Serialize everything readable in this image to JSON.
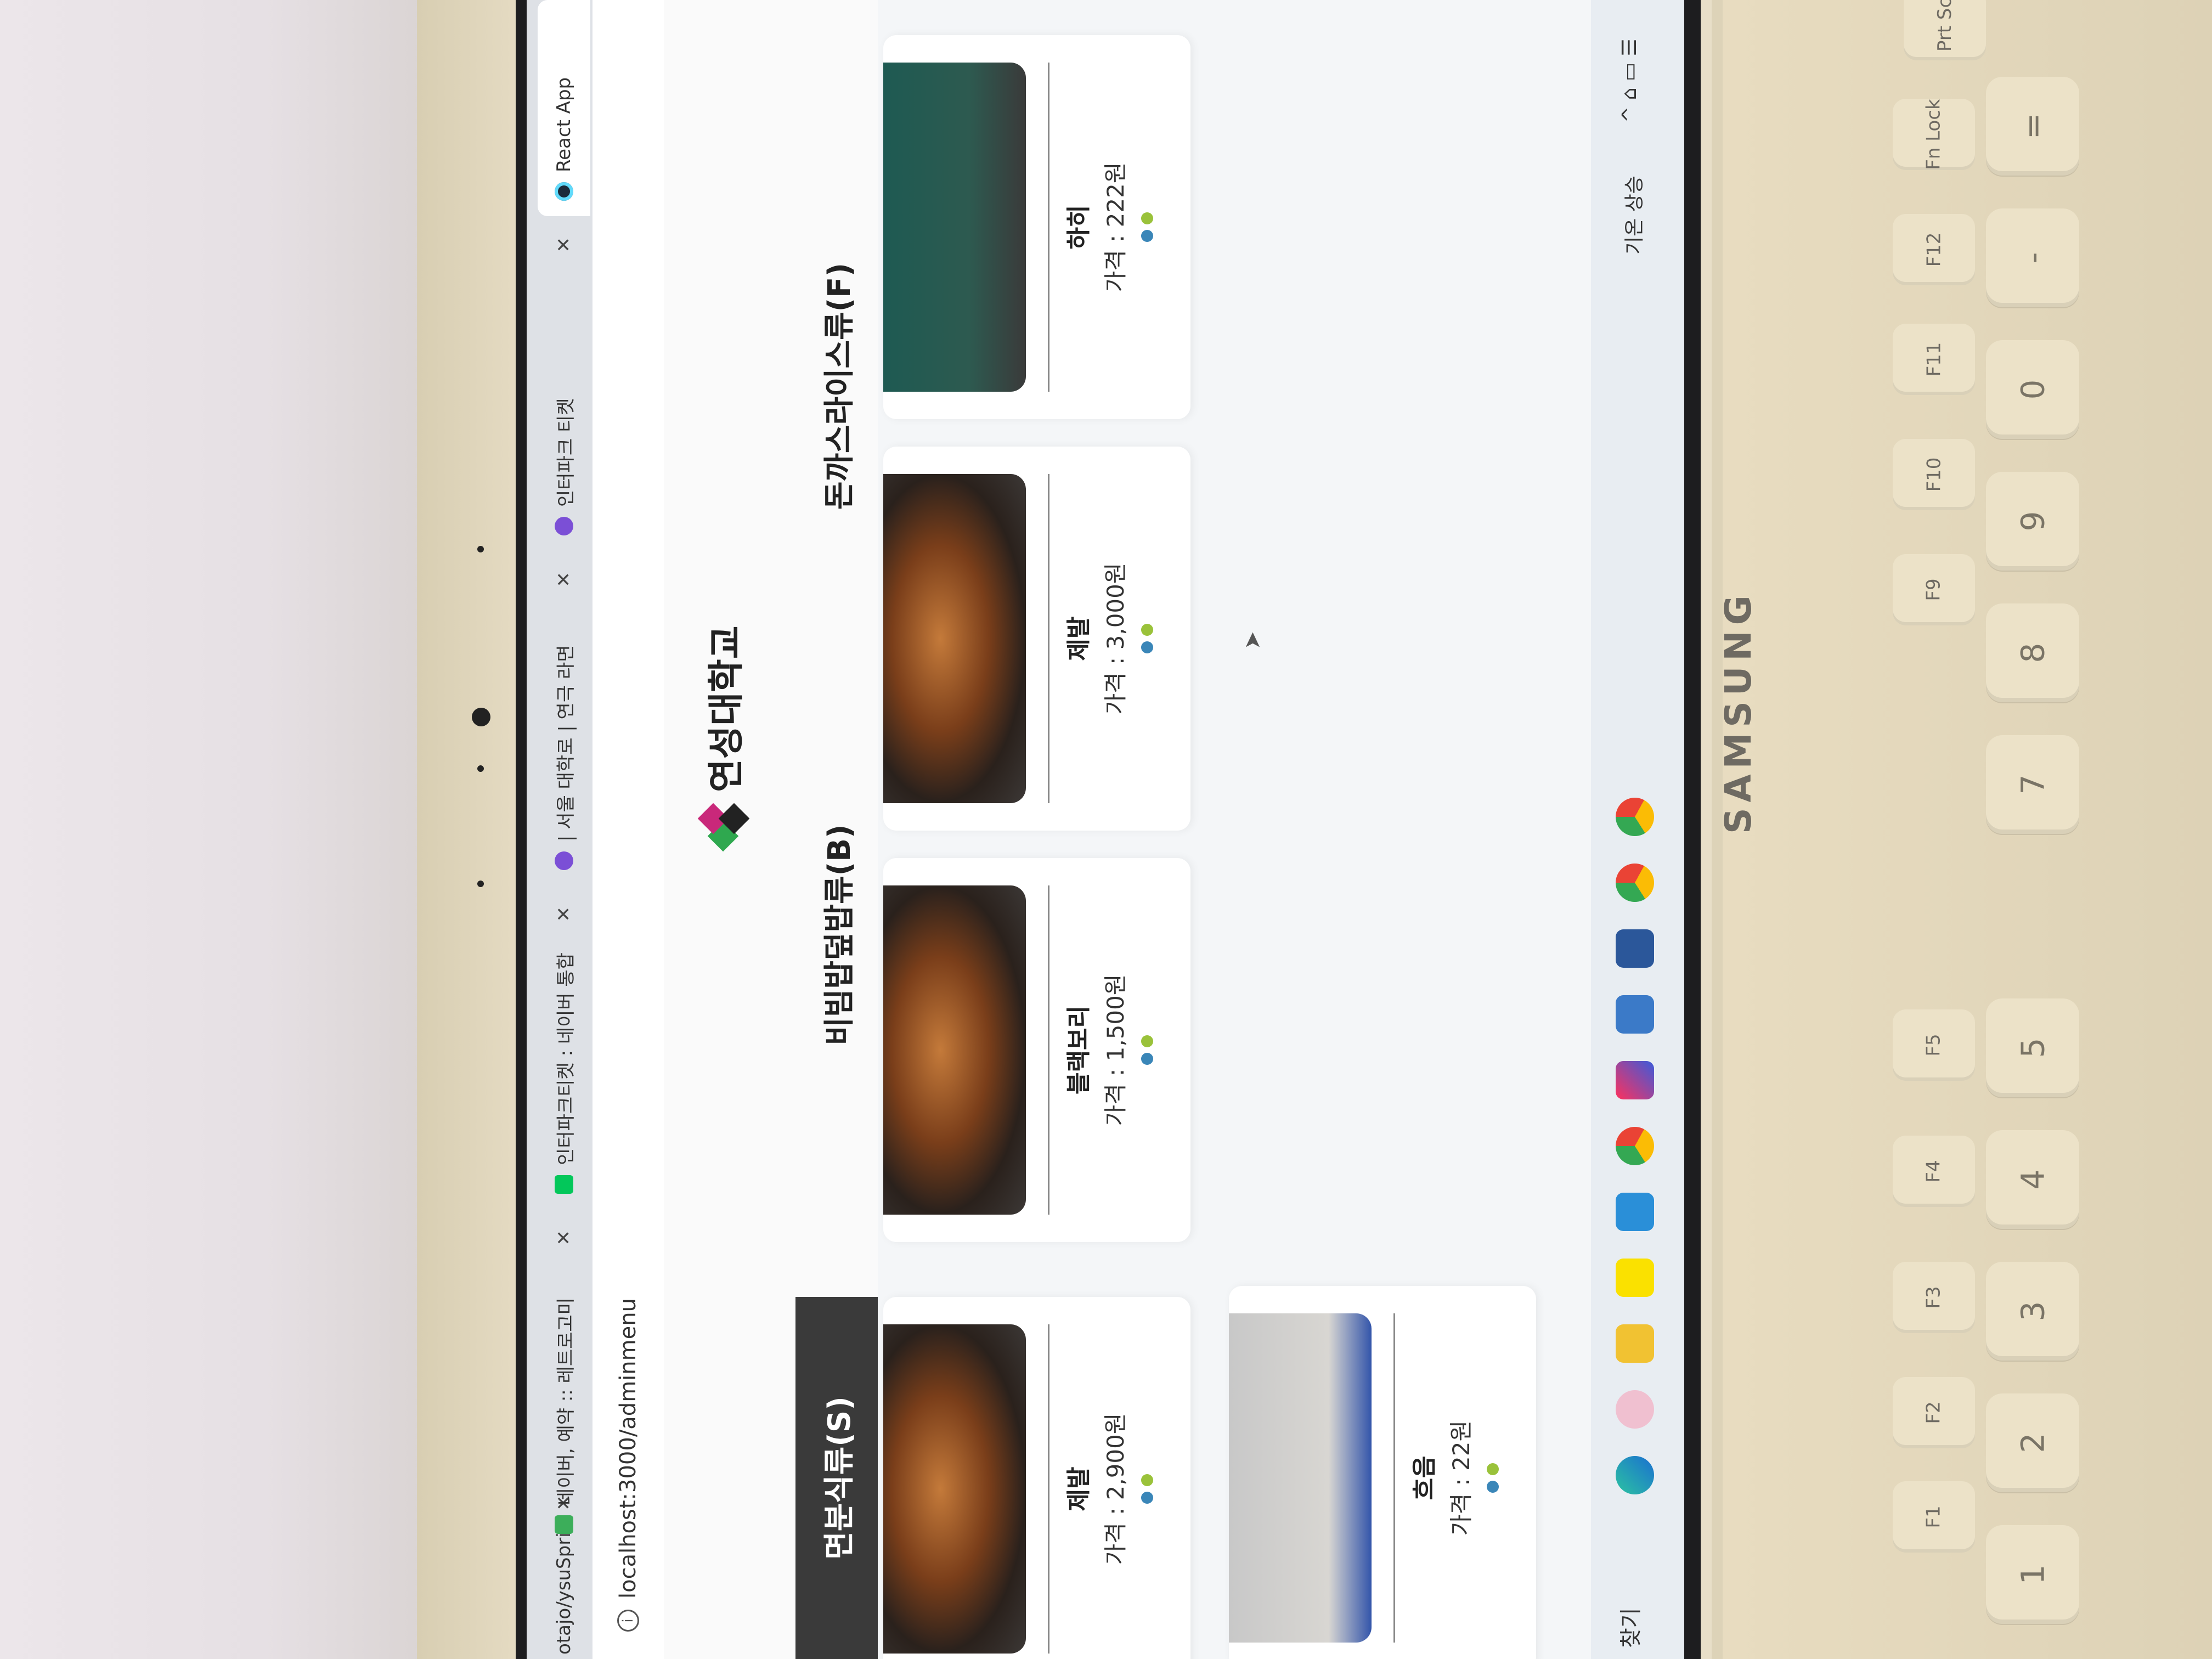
{
  "browser": {
    "tabs": [
      {
        "title": "otajo/ysuSprin",
        "favicon": "github-icon"
      },
      {
        "title": "네이버, 예약 :: 레트로고미",
        "favicon": "naver-booking-icon"
      },
      {
        "title": "인터파크티켓 : 네이버 통합",
        "favicon": "naver-icon"
      },
      {
        "title": "| 서울 대학로 | 연극 라면",
        "favicon": "interpark-icon"
      },
      {
        "title": "인터파크 티켓",
        "favicon": "interpark-icon"
      },
      {
        "title": "React App",
        "favicon": "react-icon"
      }
    ],
    "url": "localhost:3000/adminmenu"
  },
  "site": {
    "logo_text": "연성대학교",
    "categories": [
      {
        "label": "면분식류(S)",
        "active": true
      },
      {
        "label": "비빔밥덮밥류(B)",
        "active": false
      },
      {
        "label": "돈까스라이스류(F)",
        "active": false
      }
    ]
  },
  "menu_items": [
    {
      "name": "제발",
      "price": "가격 : 2,900원",
      "image": "noodle-dish"
    },
    {
      "name": "블랙보리",
      "price": "가격 : 1,500원",
      "image": "noodle-dish"
    },
    {
      "name": "제발",
      "price": "가격 : 3,000원",
      "image": "noodle-dish"
    },
    {
      "name": "하히",
      "price": "가격 : 222원",
      "image": "room-photo"
    },
    {
      "name": "흐음",
      "price": "가격 : 22원",
      "image": "laptop-photo"
    }
  ],
  "taskbar": {
    "search_label": "찾기",
    "weather": "기온 상승",
    "apps": [
      "edge-icon",
      "photos-icon",
      "file-explorer-icon",
      "kakaotalk-icon",
      "vscode-icon",
      "chrome-icon",
      "intellij-icon",
      "app-icon",
      "word-icon",
      "chrome-icon",
      "chrome-icon"
    ]
  },
  "hardware": {
    "brand": "SAMSUNG",
    "keys": [
      "1",
      "2",
      "3",
      "4",
      "5",
      "7",
      "8",
      "9",
      "0",
      "-",
      "=",
      "!",
      "@",
      "#",
      "$",
      "%",
      "*",
      "(",
      ")",
      "+"
    ],
    "fkeys": [
      "F1",
      "F2",
      "F3",
      "F4",
      "F5",
      "F9",
      "F10",
      "F11",
      "F12",
      "Fn Lock",
      "Prt Sc"
    ]
  },
  "colors": {
    "dot_blue": "#3a86b8",
    "dot_green": "#9ac23a",
    "active_category": "#3a3a3a"
  }
}
